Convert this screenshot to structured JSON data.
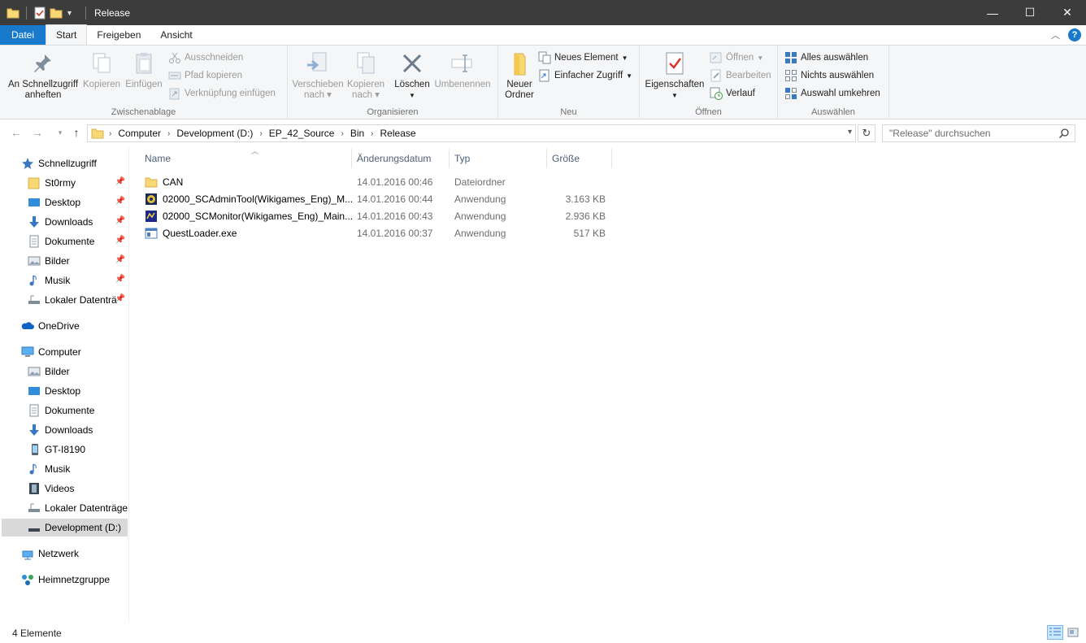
{
  "window": {
    "title": "Release",
    "controls": {
      "minimize": "—",
      "maximize": "☐",
      "close": "✕"
    }
  },
  "ribbon_tabs": [
    "Datei",
    "Start",
    "Freigeben",
    "Ansicht"
  ],
  "ribbon": {
    "zwischenablage": {
      "label": "Zwischenablage",
      "pin_line1": "An Schnellzugriff",
      "pin_line2": "anheften",
      "copy": "Kopieren",
      "paste": "Einfügen",
      "cut": "Ausschneiden",
      "copy_path": "Pfad kopieren",
      "paste_shortcut": "Verknüpfung einfügen"
    },
    "organisieren": {
      "label": "Organisieren",
      "move_line1": "Verschieben",
      "move_line2": "nach",
      "copyto_line1": "Kopieren",
      "copyto_line2": "nach",
      "delete": "Löschen",
      "rename": "Umbenennen"
    },
    "neu": {
      "label": "Neu",
      "new_folder_line1": "Neuer",
      "new_folder_line2": "Ordner",
      "new_item": "Neues Element",
      "easy_access": "Einfacher Zugriff"
    },
    "oeffnen": {
      "label": "Öffnen",
      "properties": "Eigenschaften",
      "open": "Öffnen",
      "edit": "Bearbeiten",
      "history": "Verlauf"
    },
    "auswaehlen": {
      "label": "Auswählen",
      "select_all": "Alles auswählen",
      "select_none": "Nichts auswählen",
      "invert": "Auswahl umkehren"
    }
  },
  "address": {
    "breadcrumbs": [
      "Computer",
      "Development (D:)",
      "EP_42_Source",
      "Bin",
      "Release"
    ],
    "search_placeholder": "\"Release\" durchsuchen"
  },
  "sidebar": {
    "quick_access": "Schnellzugriff",
    "quick_items": [
      "St0rmy",
      "Desktop",
      "Downloads",
      "Dokumente",
      "Bilder",
      "Musik",
      "Lokaler Datenträ"
    ],
    "onedrive": "OneDrive",
    "computer": "Computer",
    "computer_items": [
      "Bilder",
      "Desktop",
      "Dokumente",
      "Downloads",
      "GT-I8190",
      "Musik",
      "Videos",
      "Lokaler Datenträger",
      "Development (D:)"
    ],
    "network": "Netzwerk",
    "homegroup": "Heimnetzgruppe"
  },
  "columns": [
    "Name",
    "Änderungsdatum",
    "Typ",
    "Größe"
  ],
  "files": [
    {
      "name": "CAN",
      "date": "14.01.2016 00:46",
      "type": "Dateiordner",
      "size": "",
      "icon": "folder-icon"
    },
    {
      "name": "02000_SCAdminTool(Wikigames_Eng)_M...",
      "date": "14.01.2016 00:44",
      "type": "Anwendung",
      "size": "3.163 KB",
      "icon": "admin-app-icon"
    },
    {
      "name": "02000_SCMonitor(Wikigames_Eng)_Main...",
      "date": "14.01.2016 00:43",
      "type": "Anwendung",
      "size": "2.936 KB",
      "icon": "monitor-app-icon"
    },
    {
      "name": "QuestLoader.exe",
      "date": "14.01.2016 00:37",
      "type": "Anwendung",
      "size": "517 KB",
      "icon": "exe-app-icon"
    }
  ],
  "status": {
    "count": "4 Elemente"
  },
  "colors": {
    "accent": "#1979ca",
    "titlebar": "#3c3c3c",
    "ribbon_bg": "#f5f6f7",
    "folder": "#f8d775"
  }
}
